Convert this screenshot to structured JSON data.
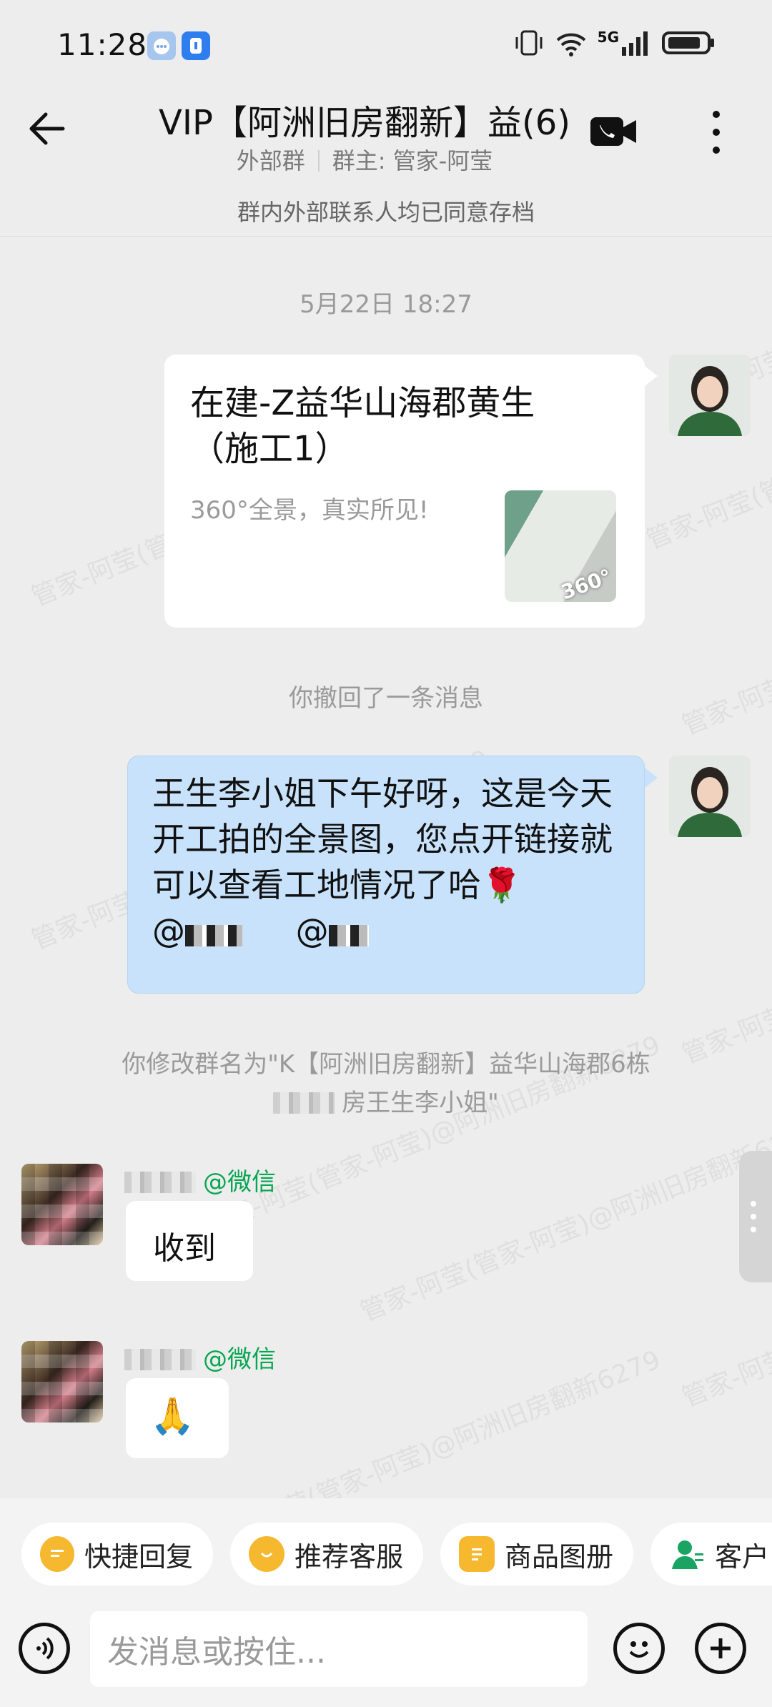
{
  "status": {
    "time": "11:28",
    "network": "5G"
  },
  "header": {
    "title": "VIP【阿洲旧房翻新】益(6)",
    "tag": "外部群",
    "owner": "群主: 管家-阿莹",
    "notice": "群内外部联系人均已同意存档"
  },
  "watermark": "管家-阿莹(管家-阿莹)@阿洲旧房翻新6279",
  "chat": {
    "timestamp": "5月22日  18:27",
    "link_card": {
      "title": "在建-Z益华山海郡黄生（施工1）",
      "description": "360°全景，真实所见!",
      "thumb_badge": "360°"
    },
    "recall_notice": "你撤回了一条消息",
    "my_message": {
      "text": "王生李小姐下午好呀，这是今天开工拍的全景图，您点开链接就可以查看工地情况了哈🌹",
      "mentions": "@"
    },
    "rename_notice_line1": "你修改群名为\"K【阿洲旧房翻新】益华山海郡6栋",
    "rename_notice_line2": "房王生李小姐\"",
    "msg1": {
      "source": "@微信",
      "text": "收到"
    },
    "msg2": {
      "source": "@微信",
      "text": "🙏"
    }
  },
  "quick_actions": [
    {
      "label": "快捷回复",
      "icon": "quick-reply-icon",
      "color": "#f5b82e"
    },
    {
      "label": "推荐客服",
      "icon": "service-icon",
      "color": "#f5b82e"
    },
    {
      "label": "商品图册",
      "icon": "catalog-icon",
      "color": "#f5b82e"
    },
    {
      "label": "客户",
      "icon": "customer-icon",
      "color": "#19a463"
    }
  ],
  "input": {
    "placeholder": "发消息或按住..."
  }
}
